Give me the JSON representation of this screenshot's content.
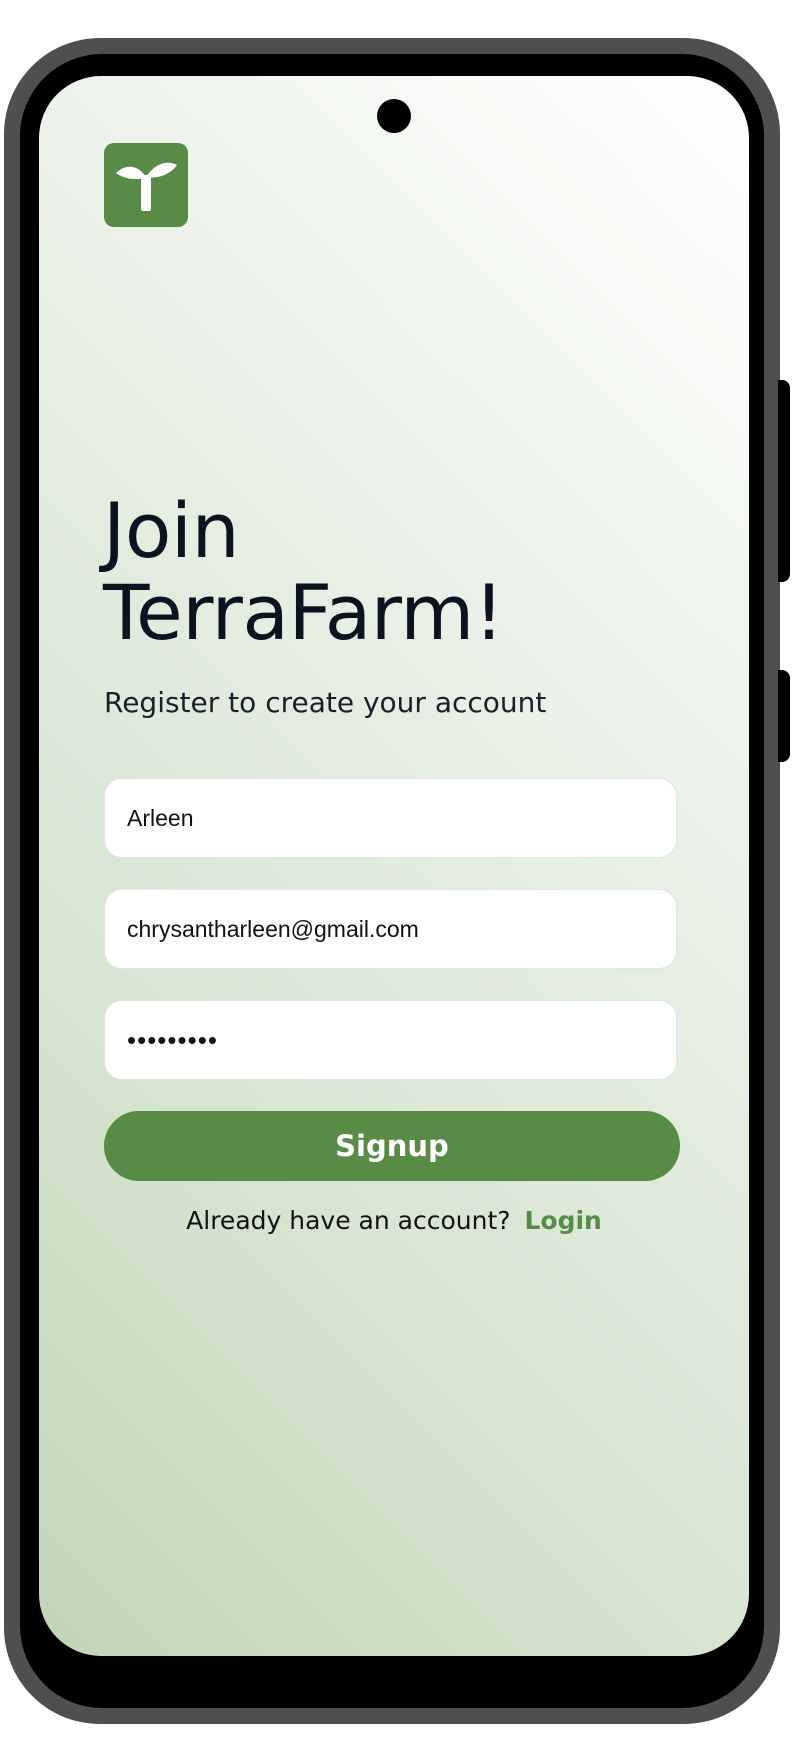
{
  "app": {
    "logo_icon": "sprout-icon",
    "brand_color": "#588c46"
  },
  "header": {
    "title_line1": "Join",
    "title_line2": "TerraFarm!",
    "subtitle": "Register to create your account"
  },
  "form": {
    "name_value": "Arleen",
    "email_value": "chrysantharleen@gmail.com",
    "password_value": "•••••••••",
    "signup_label": "Signup"
  },
  "footer": {
    "prompt": "Already have an account?",
    "login_label": "Login"
  }
}
